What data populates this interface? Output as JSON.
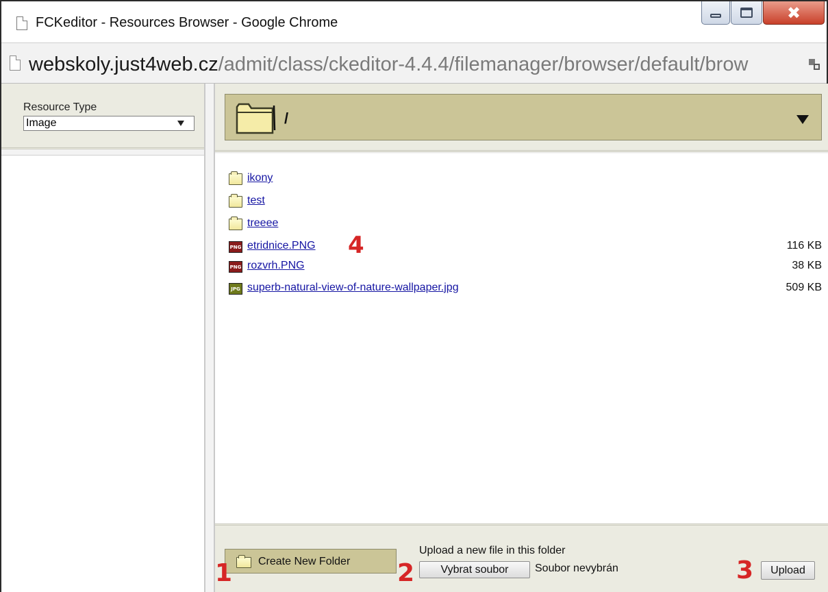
{
  "window": {
    "title": "FCKeditor - Resources Browser - Google Chrome",
    "controls": {
      "minimize": "minimize-icon",
      "maximize": "maximize-icon",
      "close": "✖"
    }
  },
  "address": {
    "host": "webskoly.just4web.cz",
    "path": "/admit/class/ckeditor-4.4.4/filemanager/browser/default/brow"
  },
  "sidebar": {
    "resource_type_label": "Resource Type",
    "resource_type_value": "Image"
  },
  "toolbar": {
    "current_path": "/"
  },
  "files": [
    {
      "name": "ikony",
      "type": "folder",
      "size": ""
    },
    {
      "name": "test",
      "type": "folder",
      "size": ""
    },
    {
      "name": "treeee",
      "type": "folder",
      "size": ""
    },
    {
      "name": "etridnice.PNG",
      "type": "png",
      "icon_text": "PNG",
      "size": "116 KB"
    },
    {
      "name": "rozvrh.PNG",
      "type": "png",
      "icon_text": "PNG",
      "size": "38 KB"
    },
    {
      "name": "superb-natural-view-of-nature-wallpaper.jpg",
      "type": "jpg",
      "icon_text": "JPG",
      "size": "509 KB"
    }
  ],
  "bottom": {
    "create_folder_label": "Create New Folder",
    "upload_label": "Upload a new file in this folder",
    "choose_file_label": "Vybrat soubor",
    "no_file_text": "Soubor nevybrán",
    "upload_button_label": "Upload"
  },
  "annotations": {
    "a1": "1",
    "a2": "2",
    "a3": "3",
    "a4": "4"
  },
  "colors": {
    "accent_olive": "#cbc597",
    "link": "#1515a3",
    "annotation_red": "#d62626"
  }
}
